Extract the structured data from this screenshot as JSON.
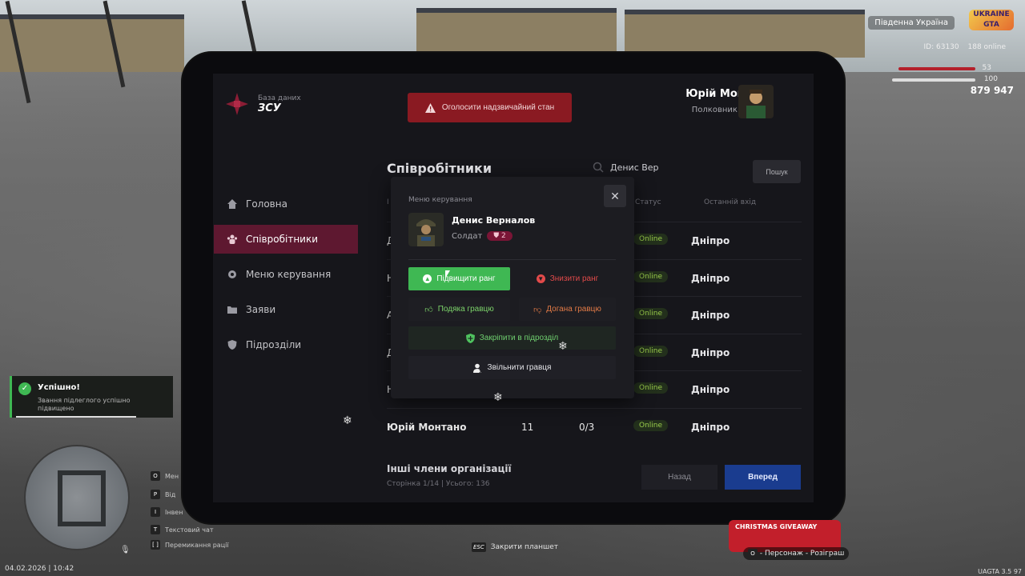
{
  "hud": {
    "server": "Південна Україна",
    "logo": "UKRAINE GTA",
    "id_text": "ID: 63130",
    "online_text": "188 online",
    "health": "53",
    "armor": "100",
    "money": "879 947",
    "datetime": "04.02.2026 | 10:42",
    "version": "UAGTA 3.5",
    "fps": "97"
  },
  "tablet": {
    "brand": {
      "subtitle": "База даних",
      "title": "ЗСУ"
    },
    "emergency_button": "Оголосити надзвичайний стан",
    "user": {
      "name": "Юрій Монтано",
      "rank_title": "Полковник",
      "rank_level": "11"
    },
    "nav": [
      {
        "label": "Головна",
        "icon": "home-icon"
      },
      {
        "label": "Співробітники",
        "icon": "users-icon",
        "active": true
      },
      {
        "label": "Меню керування",
        "icon": "gear-icon"
      },
      {
        "label": "Заяви",
        "icon": "folder-icon"
      },
      {
        "label": "Підрозділи",
        "icon": "shield-icon"
      }
    ],
    "section_title": "Співробітники",
    "search": {
      "value": "Денис Вер",
      "button": "Пошук"
    },
    "table": {
      "headers": {
        "name": "І",
        "status": "Статус",
        "last_login": "Останній вхід"
      },
      "rows": [
        {
          "name": "Д",
          "rank": "",
          "warns": "",
          "status": "Online",
          "city": "Дніпро"
        },
        {
          "name": "Н",
          "rank": "",
          "warns": "",
          "status": "Online",
          "city": "Дніпро"
        },
        {
          "name": "А",
          "rank": "",
          "warns": "",
          "status": "Online",
          "city": "Дніпро"
        },
        {
          "name": "Д",
          "rank": "",
          "warns": "",
          "status": "Online",
          "city": "Дніпро"
        },
        {
          "name": "Н",
          "rank": "",
          "warns": "",
          "status": "Online",
          "city": "Дніпро"
        },
        {
          "name": "Юрій Монтано",
          "rank": "11",
          "warns": "0/3",
          "status": "Online",
          "city": "Дніпро"
        }
      ]
    },
    "others_title": "Інші члени організації",
    "pager": "Сторінка 1/14 | Усього: 136",
    "back": "Назад",
    "next": "Вперед"
  },
  "modal": {
    "title": "Меню керування",
    "employee": {
      "name": "Денис Верналов",
      "rank_title": "Солдат",
      "rank_level": "2"
    },
    "buttons": {
      "promote": "Підвищити ранг",
      "demote": "Знизити ранг",
      "thanks": "Подяка гравцю",
      "reprimand": "Догана гравцю",
      "assign": "Закріпити в підрозділ",
      "dismiss": "Звільнити гравця"
    }
  },
  "toast": {
    "title": "Успішно!",
    "text": "Звання підлеглого успішно підвищено"
  },
  "hints": [
    {
      "key": "O",
      "label": "Мен"
    },
    {
      "key": "P",
      "label": "Від"
    },
    {
      "key": "I",
      "label": "Інвен"
    },
    {
      "key": "T",
      "label": "Текстовий чат"
    },
    {
      "key": "[ ]",
      "label": "Перемикання рації"
    }
  ],
  "esc_hint": {
    "key": "ESC",
    "label": "Закрити планшет"
  },
  "promo": {
    "title": "CHRISTMAS GIVEAWAY",
    "hint_key": "O",
    "hint": "- Персонаж - Розіграш"
  },
  "colors": {
    "accent": "#5e1830",
    "success": "#3fb853",
    "danger": "#8a1a22",
    "primary": "#1a3c8f"
  }
}
